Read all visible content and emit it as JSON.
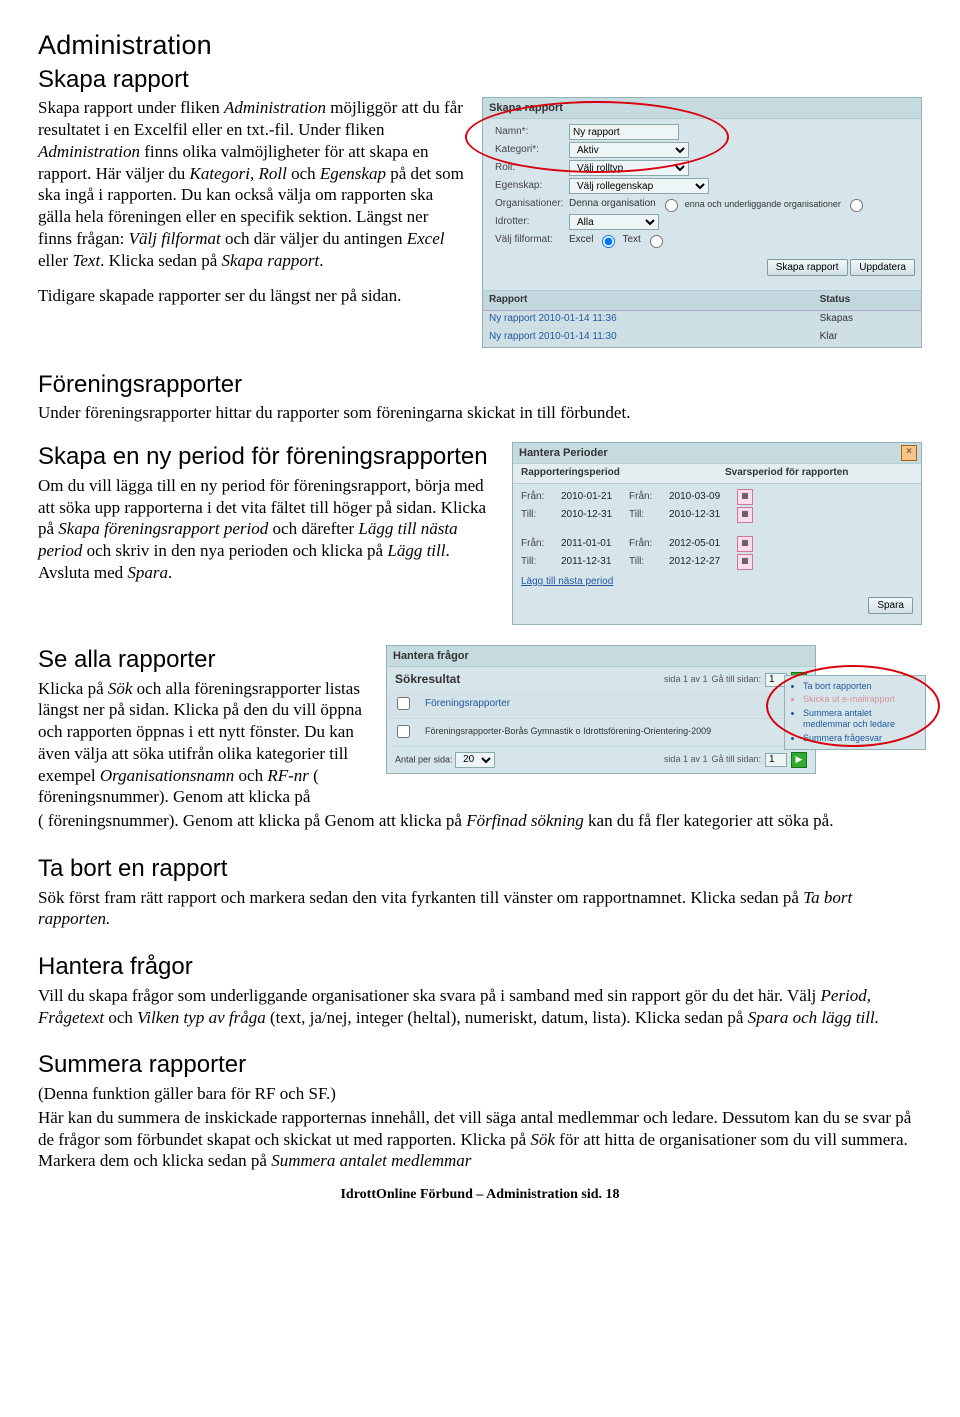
{
  "page_title": "Administration",
  "sections": {
    "skapa_rapport": {
      "heading": "Skapa rapport",
      "p1a": "Skapa rapport under fliken ",
      "p1b": "Administration",
      "p1c": " möjliggör att du får resultatet i en Excelfil eller en txt.-fil. Under fliken ",
      "p1d": "Administration",
      "p1e": " finns olika valmöjligheter för att skapa en rapport. Här väljer du ",
      "p1f": "Kategori, Roll",
      "p1g": " och ",
      "p1h": "Egenskap",
      "p1i": " på det som ska ingå i rapporten. Du kan också välja om rapporten ska gälla hela föreningen eller en specifik sektion. Längst ner finns frågan: ",
      "p1j": "Välj filformat",
      "p1k": " och där väljer du antingen ",
      "p1l": "Excel",
      "p1m": " eller ",
      "p1n": "Text",
      "p1o": ". Klicka sedan på ",
      "p1p": "Skapa rapport",
      "p1q": ".",
      "p2": "Tidigare skapade rapporter ser du längst ner på sidan.",
      "panel": {
        "header": "Skapa rapport",
        "labels": {
          "namn": "Namn*:",
          "kategori": "Kategori*:",
          "roll": "Roll:",
          "egenskap": "Egenskap:",
          "organisationer": "Organisationer:",
          "idrotter": "Idrotter:",
          "filformat": "Välj filformat:"
        },
        "values": {
          "namn": "Ny rapport",
          "kategori": "Aktiv",
          "roll": "Välj rolltyp",
          "egenskap": "Välj rollegenskap",
          "org_opt1": "Denna organisation",
          "org_opt2": "enna och underliggande organisationer",
          "idrotter": "Alla",
          "ff_excel": "Excel",
          "ff_text": "Text"
        },
        "btn_skapa": "Skapa rapport",
        "btn_uppdatera": "Uppdatera",
        "report_table": {
          "col_rapport": "Rapport",
          "col_status": "Status",
          "rows": [
            {
              "name": "Ny rapport 2010-01-14 11:36",
              "status": "Skapas"
            },
            {
              "name": "Ny rapport 2010-01-14 11:30",
              "status": "Klar"
            }
          ]
        }
      }
    },
    "foreningsrapporter": {
      "heading": "Föreningsrapporter",
      "p1": "Under föreningsrapporter hittar du rapporter som föreningarna skickat in till förbundet."
    },
    "skapa_period": {
      "heading": "Skapa en ny period för föreningsrapporten",
      "p1a": "Om du vill lägga till en ny period för föreningsrapport, börja med att söka upp rapporterna i det vita fältet till höger på sidan. Klicka på ",
      "p1b": "Skapa föreningsrapport period",
      "p1c": " och därefter ",
      "p1d": "Lägg till nästa period",
      "p1e": " och skriv in den nya perioden och klicka på ",
      "p1f": "Lägg till",
      "p1g": ". Avsluta med ",
      "p1h": "Spara",
      "p1i": ".",
      "panel": {
        "header": "Hantera Perioder",
        "col1": "Rapporteringsperiod",
        "col2": "Svarsperiod för rapporten",
        "fran": "Från:",
        "till": "Till:",
        "rows": [
          {
            "rp_from": "2010-01-21",
            "rp_to": "2010-12-31",
            "sp_from": "2010-03-09",
            "sp_to": "2010-12-31"
          },
          {
            "rp_from": "2011-01-01",
            "rp_to": "2011-12-31",
            "sp_from": "2012-05-01",
            "sp_to": "2012-12-27"
          }
        ],
        "link": "Lägg till nästa period",
        "btn_spara": "Spara"
      }
    },
    "se_alla": {
      "heading": "Se alla rapporter",
      "p1a": "Klicka på ",
      "p1b": "Sök",
      "p1c": " och alla föreningsrapporter listas längst ner på sidan. Klicka på den du vill öppna och rapporten öppnas i ett nytt fönster. Du kan även välja att söka utifrån olika kategorier till exempel ",
      "p1d": "Organisationsnamn",
      "p1e": " och ",
      "p1f": "RF-nr",
      "p1g": " ( föreningsnummer). Genom att klicka på ",
      "p1h": "Förfinad sökning",
      "p1i": " kan du få fler kategorier att söka på.",
      "panel": {
        "header": "Hantera frågor",
        "search": "Sökresultat",
        "pager1": "sida 1 av 1",
        "pager_label": "Gå till sidan:",
        "pager_val": "1",
        "col1": "Föreningsrapporter",
        "row1": "Föreningsrapporter-Borås Gymnastik o Idrottsförening-Orientering-2009",
        "antal_label": "Antal per sida:",
        "antal_val": "20",
        "menu": {
          "i1": "Ta bort rapporten",
          "i2": "Skicka ut e-mailrapport",
          "i3": "Summera antalet medlemmar och ledare",
          "i4": "Summera frågesvar"
        }
      }
    },
    "ta_bort": {
      "heading": "Ta bort en rapport",
      "p1a": "Sök först fram rätt rapport och markera sedan den vita fyrkanten till vänster om rapportnamnet. Klicka sedan på ",
      "p1b": "Ta bort rapporten.",
      "p1c": ""
    },
    "hantera_fragor": {
      "heading": "Hantera frågor",
      "p1a": "Vill du skapa frågor som underliggande organisationer ska svara på i samband med sin rapport gör du det här. Välj ",
      "p1b": "Period, Frågetext",
      "p1c": " och ",
      "p1d": "Vilken typ av fråga",
      "p1e": " (text, ja/nej, integer (heltal), numeriskt, datum, lista). Klicka sedan på ",
      "p1f": "Spara och lägg till.",
      "p1g": ""
    },
    "summera": {
      "heading": "Summera rapporter",
      "p0": "(Denna funktion gäller bara för RF och SF.)",
      "p1a": "Här kan du summera de inskickade rapporternas innehåll, det vill säga antal medlemmar och ledare. Dessutom kan du se svar på de frågor som förbundet skapat och skickat ut med rapporten. Klicka på ",
      "p1b": "Sök",
      "p1c": " för att hitta de organisationer som du vill summera. Markera dem och klicka sedan på ",
      "p1d": "Summera antalet medlemmar"
    }
  },
  "footer": "IdrottOnline Förbund – Administration sid. 18"
}
